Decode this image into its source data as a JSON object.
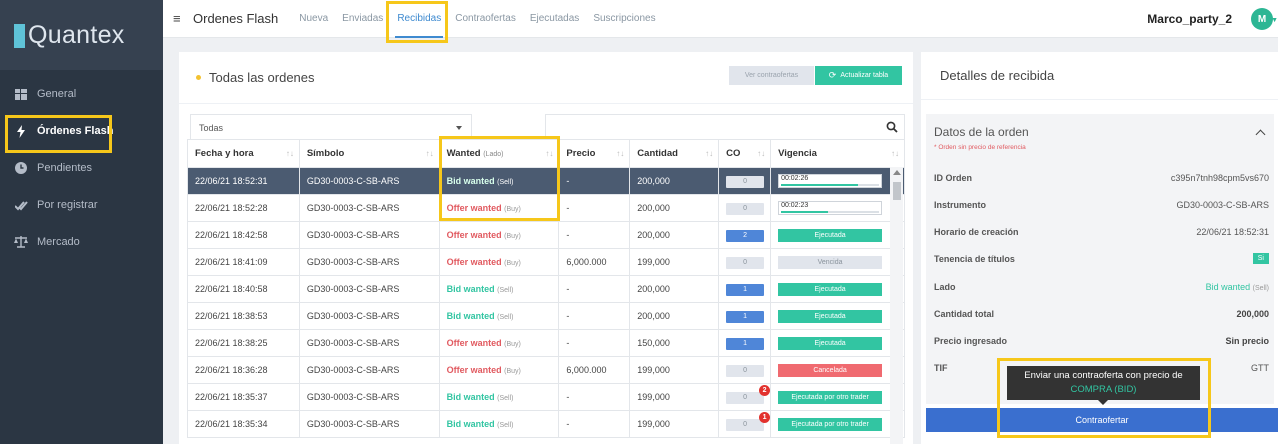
{
  "brand": {
    "name": "Quantex"
  },
  "sidebar": {
    "items": [
      {
        "label": "General",
        "icon": "grid-icon"
      },
      {
        "label": "Órdenes Flash",
        "icon": "bolt-icon"
      },
      {
        "label": "Pendientes",
        "icon": "clock-icon"
      },
      {
        "label": "Por registrar",
        "icon": "double-check-icon"
      },
      {
        "label": "Mercado",
        "icon": "scale-icon"
      }
    ]
  },
  "topbar": {
    "title": "Ordenes Flash",
    "tabs": [
      "Nueva",
      "Enviadas",
      "Recibidas",
      "Contraofertas",
      "Ejecutadas",
      "Suscripciones"
    ],
    "active_tab": "Recibidas",
    "user": "Marco_party_2",
    "avatar_initial": "M"
  },
  "orders_panel": {
    "title": "Todas las ordenes",
    "btn_ver": "Ver contraofertas",
    "btn_actualizar": "Actualizar tabla",
    "filter_value": "Todas",
    "columns": [
      "Fecha y hora",
      "Símbolo",
      "Wanted",
      "Precio",
      "Cantidad",
      "CO",
      "Vigencia"
    ],
    "wanted_sub": "(Lado)",
    "rows": [
      {
        "fecha": "22/06/21 18:52:31",
        "simbolo": "GD30-0003-C-SB-ARS",
        "wanted": "Bid wanted",
        "lado": "(Sell)",
        "precio": "-",
        "cantidad": "200,000",
        "co": "0",
        "vig": "00:02:26",
        "vig_fraction": 0.78
      },
      {
        "fecha": "22/06/21 18:52:28",
        "simbolo": "GD30-0003-C-SB-ARS",
        "wanted": "Offer wanted",
        "lado": "(Buy)",
        "precio": "-",
        "cantidad": "200,000",
        "co": "0",
        "vig": "00:02:23",
        "vig_fraction": 0.48
      },
      {
        "fecha": "22/06/21 18:42:58",
        "simbolo": "GD30-0003-C-SB-ARS",
        "wanted": "Offer wanted",
        "lado": "(Buy)",
        "precio": "-",
        "cantidad": "200,000",
        "co": "2",
        "vig": "Ejecutada"
      },
      {
        "fecha": "22/06/21 18:41:09",
        "simbolo": "GD30-0003-C-SB-ARS",
        "wanted": "Offer wanted",
        "lado": "(Buy)",
        "precio": "6,000.000",
        "cantidad": "199,000",
        "co": "0",
        "vig": "Vencida"
      },
      {
        "fecha": "22/06/21 18:40:58",
        "simbolo": "GD30-0003-C-SB-ARS",
        "wanted": "Bid wanted",
        "lado": "(Sell)",
        "precio": "-",
        "cantidad": "200,000",
        "co": "1",
        "vig": "Ejecutada"
      },
      {
        "fecha": "22/06/21 18:38:53",
        "simbolo": "GD30-0003-C-SB-ARS",
        "wanted": "Bid wanted",
        "lado": "(Sell)",
        "precio": "-",
        "cantidad": "200,000",
        "co": "1",
        "vig": "Ejecutada"
      },
      {
        "fecha": "22/06/21 18:38:25",
        "simbolo": "GD30-0003-C-SB-ARS",
        "wanted": "Offer wanted",
        "lado": "(Buy)",
        "precio": "-",
        "cantidad": "150,000",
        "co": "1",
        "vig": "Ejecutada"
      },
      {
        "fecha": "22/06/21 18:36:28",
        "simbolo": "GD30-0003-C-SB-ARS",
        "wanted": "Offer wanted",
        "lado": "(Buy)",
        "precio": "6,000.000",
        "cantidad": "199,000",
        "co": "0",
        "vig": "Cancelada"
      },
      {
        "fecha": "22/06/21 18:35:37",
        "simbolo": "GD30-0003-C-SB-ARS",
        "wanted": "Bid wanted",
        "lado": "(Sell)",
        "precio": "-",
        "cantidad": "199,000",
        "co": "0",
        "notif": "2",
        "vig": "Ejecutada por otro trader"
      },
      {
        "fecha": "22/06/21 18:35:34",
        "simbolo": "GD30-0003-C-SB-ARS",
        "wanted": "Bid wanted",
        "lado": "(Sell)",
        "precio": "-",
        "cantidad": "199,000",
        "co": "0",
        "notif": "1",
        "vig": "Ejecutada por otro trader"
      }
    ]
  },
  "detail_panel": {
    "title": "Detalles de recibida",
    "section_title": "Datos de la orden",
    "note": "* Orden sin precio de referencia",
    "fields": [
      {
        "k": "ID Orden",
        "v": "c395n7tnh98cpm5vs670"
      },
      {
        "k": "Instrumento",
        "v": "GD30-0003-C-SB-ARS"
      },
      {
        "k": "Horario de creación",
        "v": "22/06/21 18:52:31"
      },
      {
        "k": "Tenencia de títulos",
        "v": "Si"
      },
      {
        "k": "Lado",
        "v": "Bid wanted",
        "sub": "(Sell)"
      },
      {
        "k": "Cantidad total",
        "v": "200,000"
      },
      {
        "k": "Precio ingresado",
        "v": "Sin precio"
      },
      {
        "k": "TIF",
        "v": "GTT"
      }
    ],
    "tooltip_line1": "Enviar una contraoferta con precio de",
    "tooltip_line2": "COMPRA (BID)",
    "button": "Contraofertar"
  },
  "colors": {
    "accent": "#32c5a2",
    "highlight": "#f6c71a",
    "offer": "#e15a60",
    "primary": "#3a6fcf"
  }
}
